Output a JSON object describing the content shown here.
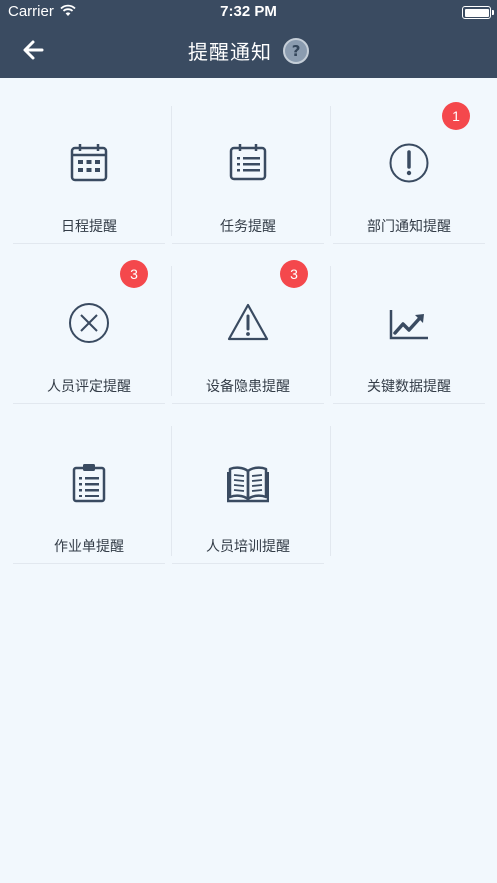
{
  "status_bar": {
    "carrier": "Carrier",
    "time": "7:32 PM"
  },
  "header": {
    "title": "提醒通知",
    "help": "?"
  },
  "tiles": [
    {
      "label": "日程提醒",
      "icon": "calendar-icon",
      "badge": null
    },
    {
      "label": "任务提醒",
      "icon": "task-list-icon",
      "badge": null
    },
    {
      "label": "部门通知提醒",
      "icon": "exclamation-circle-icon",
      "badge": "1"
    },
    {
      "label": "人员评定提醒",
      "icon": "x-circle-icon",
      "badge": "3"
    },
    {
      "label": "设备隐患提醒",
      "icon": "warning-triangle-icon",
      "badge": "3"
    },
    {
      "label": "关键数据提醒",
      "icon": "line-chart-icon",
      "badge": null
    },
    {
      "label": "作业单提醒",
      "icon": "clipboard-icon",
      "badge": null
    },
    {
      "label": "人员培训提醒",
      "icon": "open-book-icon",
      "badge": null
    }
  ],
  "colors": {
    "header_bg": "#3a4b61",
    "page_bg": "#f2f8fd",
    "icon": "#3a4b61",
    "badge": "#f4484c",
    "label": "#333c47"
  }
}
